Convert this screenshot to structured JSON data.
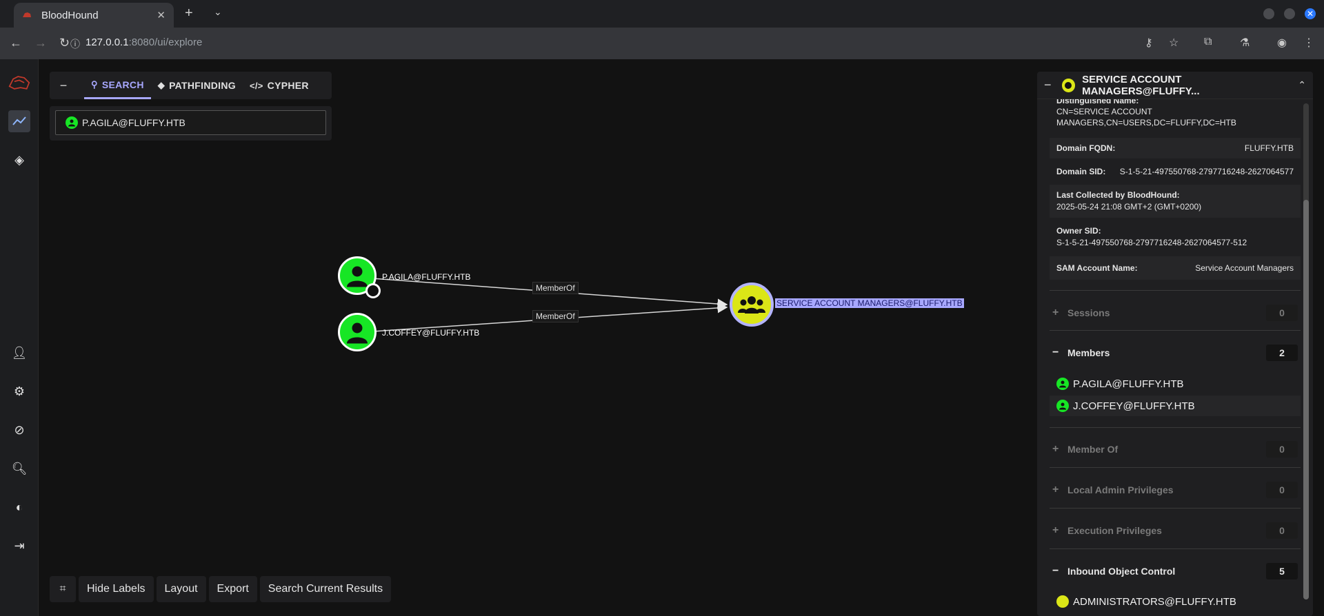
{
  "browser": {
    "tab_title": "BloodHound",
    "url_host": "127.0.0.1",
    "url_rest": ":8080/ui/explore"
  },
  "search_panel": {
    "tabs": [
      {
        "label": "SEARCH",
        "icon": "search-icon",
        "active": true
      },
      {
        "label": "PATHFINDING",
        "icon": "pathfinding-icon",
        "active": false
      },
      {
        "label": "CYPHER",
        "icon": "code-icon",
        "active": false
      }
    ],
    "search_value": "P.AGILA@FLUFFY.HTB"
  },
  "graph": {
    "nodes": [
      {
        "label": "P.AGILA@FLUFFY.HTB",
        "type": "user",
        "owned": true
      },
      {
        "label": "J.COFFEY@FLUFFY.HTB",
        "type": "user",
        "owned": false
      },
      {
        "label": "SERVICE ACCOUNT MANAGERS@FLUFFY.HTB",
        "type": "group",
        "selected": true
      }
    ],
    "edges": [
      {
        "label": "MemberOf",
        "from": "P.AGILA@FLUFFY.HTB",
        "to": "SERVICE ACCOUNT MANAGERS@FLUFFY.HTB"
      },
      {
        "label": "MemberOf",
        "from": "J.COFFEY@FLUFFY.HTB",
        "to": "SERVICE ACCOUNT MANAGERS@FLUFFY.HTB"
      }
    ],
    "colors": {
      "user": "#17e625",
      "group": "#dbe617",
      "selection": "#a8a8ff"
    }
  },
  "bottom_bar": {
    "hide_labels": "Hide Labels",
    "layout": "Layout",
    "export": "Export",
    "search_current": "Search Current Results"
  },
  "entity_panel": {
    "title": "SERVICE ACCOUNT MANAGERS@FLUFFY...",
    "dn_label": "Distinguished Name:",
    "dn_value_1": "CN=SERVICE ACCOUNT",
    "dn_value_2": "MANAGERS,CN=USERS,DC=FLUFFY,DC=HTB",
    "domain_fqdn_label": "Domain FQDN:",
    "domain_fqdn_value": "FLUFFY.HTB",
    "domain_sid_label": "Domain SID:",
    "domain_sid_value": "S-1-5-21-497550768-2797716248-2627064577",
    "last_collected_label": "Last Collected by BloodHound:",
    "last_collected_value": "2025-05-24 21:08 GMT+2 (GMT+0200)",
    "owner_sid_label": "Owner SID:",
    "owner_sid_value": "S-1-5-21-497550768-2797716248-2627064577-512",
    "sam_label": "SAM Account Name:",
    "sam_value": "Service Account Managers",
    "sections": {
      "sessions": {
        "label": "Sessions",
        "count": "0"
      },
      "members": {
        "label": "Members",
        "count": "2"
      },
      "member_of": {
        "label": "Member Of",
        "count": "0"
      },
      "local_admin": {
        "label": "Local Admin Privileges",
        "count": "0"
      },
      "execution": {
        "label": "Execution Privileges",
        "count": "0"
      },
      "inbound_control": {
        "label": "Inbound Object Control",
        "count": "5"
      }
    },
    "members": [
      "P.AGILA@FLUFFY.HTB",
      "J.COFFEY@FLUFFY.HTB"
    ],
    "inbound_first": "ADMINISTRATORS@FLUFFY.HTB"
  }
}
